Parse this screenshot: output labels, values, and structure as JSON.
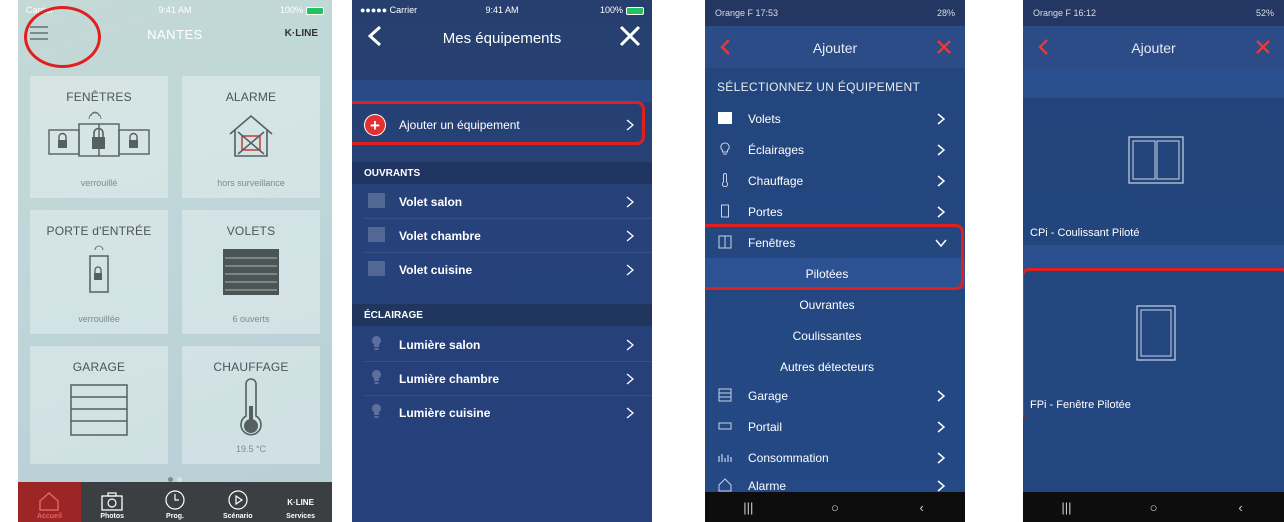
{
  "screen1": {
    "status": {
      "carrier": "Carrier",
      "time": "9:41 AM",
      "battery": "100%"
    },
    "title": "NANTES",
    "brand": "K·LINE",
    "tiles": [
      {
        "title": "FENÊTRES",
        "status": "verrouillé",
        "icon": "windows-lock-icon"
      },
      {
        "title": "ALARME",
        "status": "hors surveillance",
        "icon": "house-alarm-icon"
      },
      {
        "title": "PORTE d'ENTRÉE",
        "status": "verrouillée",
        "icon": "door-lock-icon"
      },
      {
        "title": "VOLETS",
        "status": "6 ouverts",
        "icon": "shutter-icon"
      },
      {
        "title": "GARAGE",
        "status": "",
        "icon": "garage-icon"
      },
      {
        "title": "CHAUFFAGE",
        "status": "19.5 °C",
        "icon": "thermometer-icon"
      }
    ],
    "tabs": [
      {
        "label": "Accueil",
        "icon": "home-icon"
      },
      {
        "label": "Photos",
        "icon": "camera-icon"
      },
      {
        "label": "Prog.",
        "icon": "clock-icon"
      },
      {
        "label": "Scénario",
        "icon": "play-icon"
      },
      {
        "label": "Services",
        "icon": "kline-icon",
        "brand": "K·LINE"
      }
    ],
    "highlight_color": "#e02020"
  },
  "screen2": {
    "status": {
      "carrier": "●●●●● Carrier",
      "time": "9:41 AM",
      "battery": "100%"
    },
    "title": "Mes équipements",
    "add_label": "Ajouter un équipement",
    "sections": [
      {
        "title": "OUVRANTS",
        "items": [
          "Volet salon",
          "Volet chambre",
          "Volet cuisine"
        ]
      },
      {
        "title": "ÉCLAIRAGE",
        "items": [
          "Lumière salon",
          "Lumière chambre",
          "Lumière cuisine"
        ]
      }
    ]
  },
  "screen3": {
    "status": {
      "left": "Orange F 17:53",
      "right": "28%"
    },
    "title": "Ajouter",
    "section_title": "SÉLECTIONNEZ UN ÉQUIPEMENT",
    "items": [
      {
        "label": "Volets",
        "icon": "shutter-icon"
      },
      {
        "label": "Éclairages",
        "icon": "bulb-icon"
      },
      {
        "label": "Chauffage",
        "icon": "thermometer-icon"
      },
      {
        "label": "Portes",
        "icon": "door-icon"
      },
      {
        "label": "Fenêtres",
        "icon": "window-icon"
      }
    ],
    "sub_items": [
      "Pilotées",
      "Ouvrantes",
      "Coulissantes",
      "Autres détecteurs"
    ],
    "items_after": [
      {
        "label": "Garage",
        "icon": "garage-icon"
      },
      {
        "label": "Portail",
        "icon": "gate-icon"
      },
      {
        "label": "Consommation",
        "icon": "consumption-icon"
      },
      {
        "label": "Alarme",
        "icon": "house-icon"
      }
    ]
  },
  "screen4": {
    "status": {
      "left": "Orange F 16:12",
      "right": "52%"
    },
    "title": "Ajouter",
    "cards": [
      {
        "label": "CPi - Coulissant Piloté",
        "icon": "sliding-window-icon"
      },
      {
        "label": "FPi - Fenêtre Pilotée",
        "icon": "window-icon"
      }
    ]
  }
}
